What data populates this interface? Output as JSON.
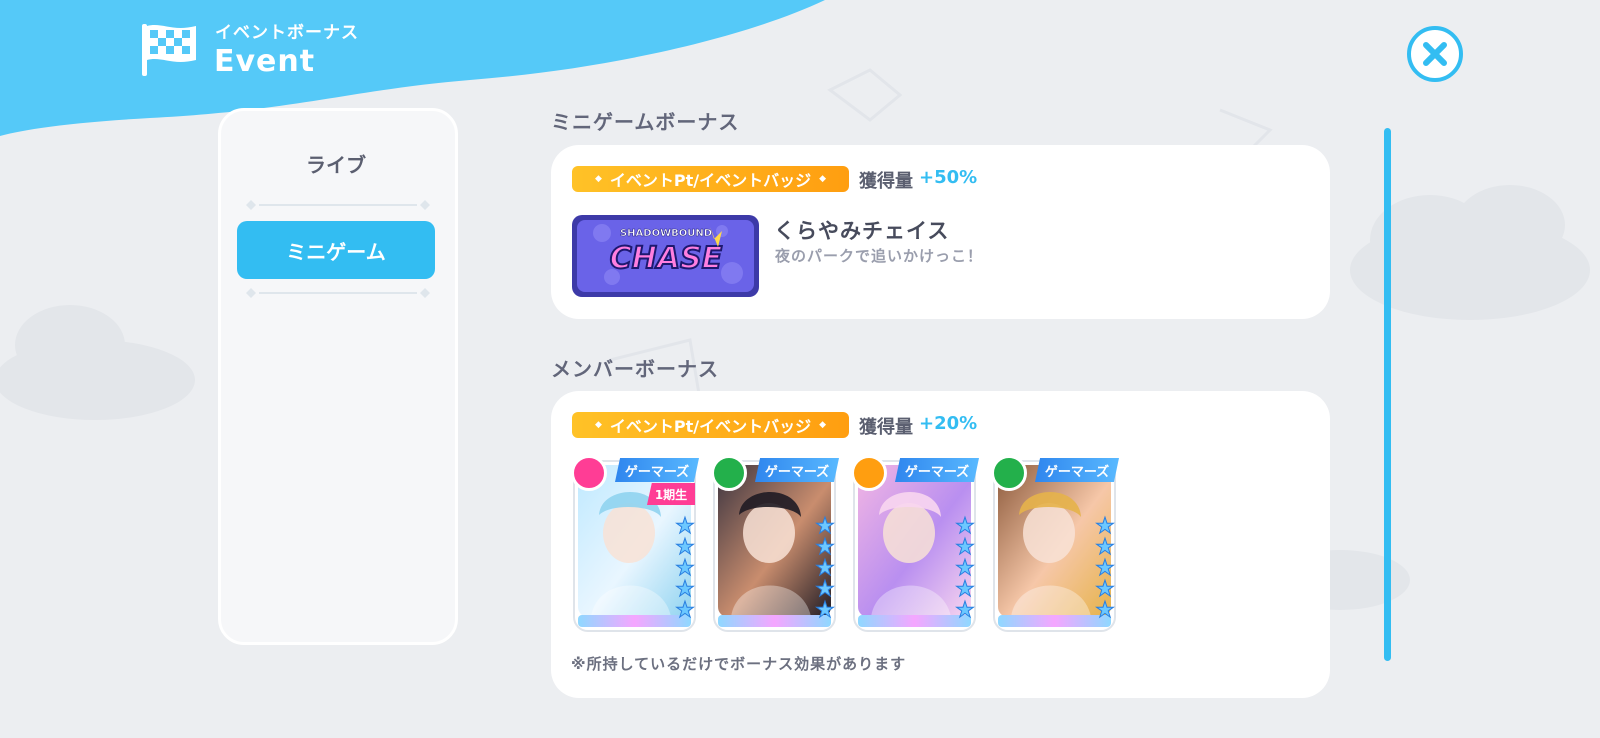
{
  "header": {
    "subtitle": "イベントボーナス",
    "title": "Event",
    "icon": "checkered-flag-icon"
  },
  "close": {
    "icon": "close-icon"
  },
  "sidebar": {
    "tabs": [
      {
        "label": "ライブ",
        "active": false
      },
      {
        "label": "ミニゲーム",
        "active": true
      }
    ]
  },
  "minigame_bonus": {
    "section_title": "ミニゲームボーナス",
    "pill_label": "イベントPt/イベントバッジ",
    "gain_label": "獲得量",
    "gain_value": "+50%",
    "game": {
      "logo_text_top": "SHADOWBOUND",
      "logo_text_main": "CHASE",
      "name": "くらやみチェイス",
      "description": "夜のパークで追いかけっこ！"
    }
  },
  "member_bonus": {
    "section_title": "メンバーボーナス",
    "pill_label": "イベントPt/イベントバッジ",
    "gain_label": "獲得量",
    "gain_value": "+20%",
    "members": [
      {
        "group": "ゲーマーズ",
        "generation": "1期生",
        "attribute": "heart-icon",
        "attr_color": "#ff3d95",
        "palette": [
          "#bfe9ff",
          "#e9f6ff",
          "#8fd3f0"
        ]
      },
      {
        "group": "ゲーマーズ",
        "generation": "",
        "attribute": "leaf-icon",
        "attr_color": "#23b04b",
        "palette": [
          "#3b3440",
          "#c98d6e",
          "#1f1b24"
        ]
      },
      {
        "group": "ゲーマーズ",
        "generation": "",
        "attribute": "sun-icon",
        "attr_color": "#ff9e10",
        "palette": [
          "#f3b6e3",
          "#b98ff0",
          "#f8d6ef"
        ]
      },
      {
        "group": "ゲーマーズ",
        "generation": "",
        "attribute": "leaf-icon",
        "attr_color": "#23b04b",
        "palette": [
          "#8c5a3c",
          "#f6c7a8",
          "#e6b34a"
        ]
      }
    ],
    "note": "※所持しているだけでボーナス効果があります"
  },
  "colors": {
    "accent": "#33bdf2",
    "pill_start": "#ffc227",
    "pill_end": "#ff9e10",
    "background": "#eceef1"
  }
}
